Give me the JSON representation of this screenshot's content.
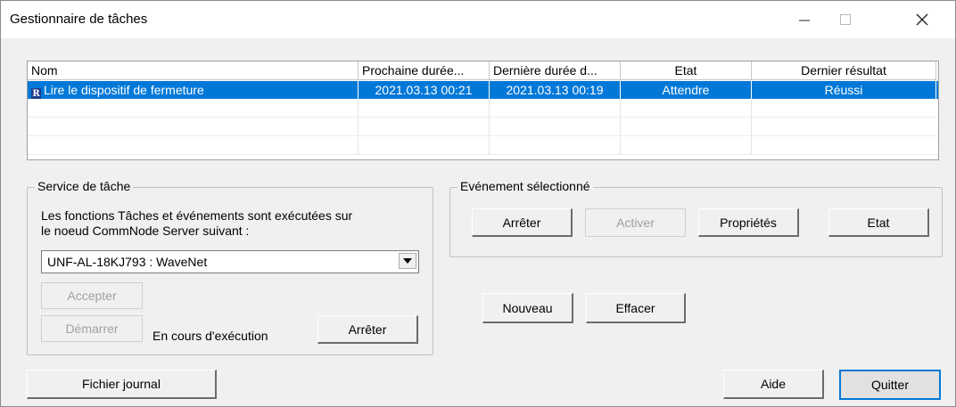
{
  "window": {
    "title": "Gestionnaire de tâches",
    "controls": {
      "minimize": "minimize-icon",
      "maximize": "maximize-icon",
      "close": "close-icon"
    }
  },
  "tasks": {
    "columns": [
      "Nom",
      "Prochaine durée...",
      "Dernière durée d...",
      "Etat",
      "Dernier résultat"
    ],
    "rows": [
      {
        "icon": "task-icon",
        "name": "Lire le dispositif de fermeture",
        "next": "2021.03.13 00:21",
        "last": "2021.03.13 00:19",
        "state": "Attendre",
        "result": "Réussi"
      }
    ]
  },
  "service": {
    "legend": "Service de tâche",
    "description_line1": "Les fonctions Tâches et événements sont exécutées sur",
    "description_line2": "le noeud CommNode Server suivant :",
    "server_value": "UNF-AL-18KJ793 : WaveNet",
    "accept_label": "Accepter",
    "start_label": "Démarrer",
    "status_text": "En cours d'exécution",
    "stop_label": "Arrêter"
  },
  "event": {
    "legend": "Evénement sélectionné",
    "stop_label": "Arrêter",
    "activate_label": "Activer",
    "properties_label": "Propriétés",
    "state_label": "Etat"
  },
  "actions": {
    "new_label": "Nouveau",
    "delete_label": "Effacer",
    "log_label": "Fichier journal",
    "help_label": "Aide",
    "quit_label": "Quitter"
  },
  "colors": {
    "selection": "#0078d7",
    "background": "#f0f0f0"
  }
}
